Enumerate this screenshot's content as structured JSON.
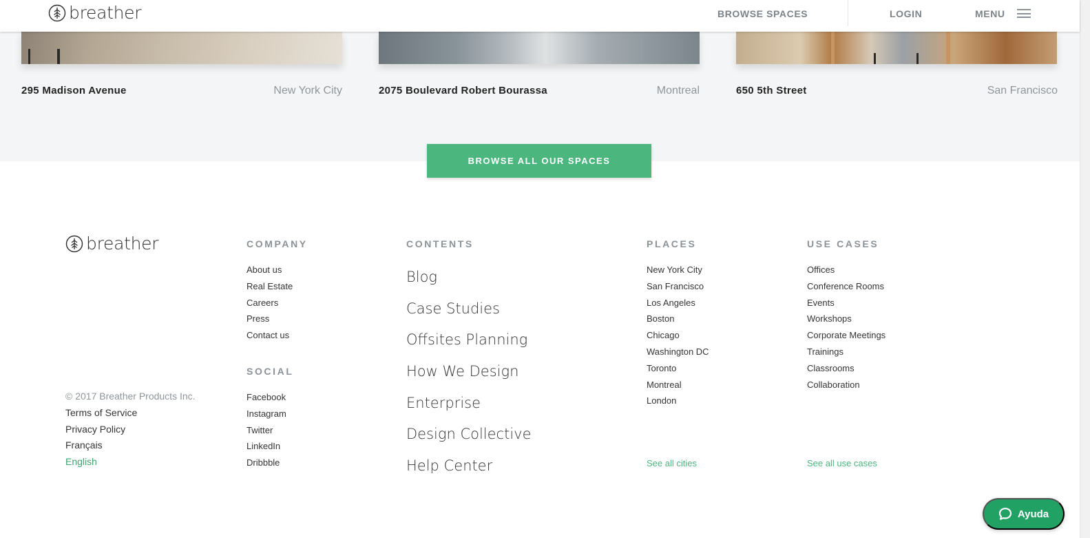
{
  "header": {
    "logo_text": "breather",
    "nav": {
      "browse_spaces": "BROWSE SPACES",
      "login": "LOGIN",
      "menu": "MENU"
    }
  },
  "featured": {
    "cards": [
      {
        "name": "295 Madison Avenue",
        "city": "New York City"
      },
      {
        "name": "2075 Boulevard Robert Bourassa",
        "city": "Montreal"
      },
      {
        "name": "650 5th Street",
        "city": "San Francisco"
      }
    ],
    "browse_all_label": "BROWSE ALL OUR SPACES"
  },
  "footer": {
    "logo_text": "breather",
    "company": {
      "title": "COMPANY",
      "items": [
        "About us",
        "Real Estate",
        "Careers",
        "Press",
        "Contact us"
      ]
    },
    "social": {
      "title": "SOCIAL",
      "items": [
        "Facebook",
        "Instagram",
        "Twitter",
        "LinkedIn",
        "Dribbble"
      ]
    },
    "contents": {
      "title": "CONTENTS",
      "items": [
        "Blog",
        "Case Studies",
        "Offsites Planning",
        "How We Design",
        "Enterprise",
        "Design Collective",
        "Help Center"
      ]
    },
    "places": {
      "title": "PLACES",
      "items": [
        "New York City",
        "San Francisco",
        "Los Angeles",
        "Boston",
        "Chicago",
        "Washington DC",
        "Toronto",
        "Montreal",
        "London"
      ],
      "see_all": "See all cities"
    },
    "use_cases": {
      "title": "USE CASES",
      "items": [
        "Offices",
        "Conference Rooms",
        "Events",
        "Workshops",
        "Corporate Meetings",
        "Trainings",
        "Classrooms",
        "Collaboration"
      ],
      "see_all": "See all use cases"
    },
    "legal": {
      "copyright": "© 2017 Breather Products Inc.",
      "terms": "Terms of Service",
      "privacy": "Privacy Policy",
      "french": "Français",
      "english": "English"
    }
  },
  "help_button": {
    "label": "Ayuda"
  },
  "colors": {
    "accent_green": "#4cb67f",
    "help_green": "#22a164",
    "muted_gray": "#8b9298",
    "section_bg": "#f4f5f6"
  },
  "icons": [
    "breather-logo-icon",
    "hamburger-menu-icon",
    "chat-bubble-icon"
  ]
}
